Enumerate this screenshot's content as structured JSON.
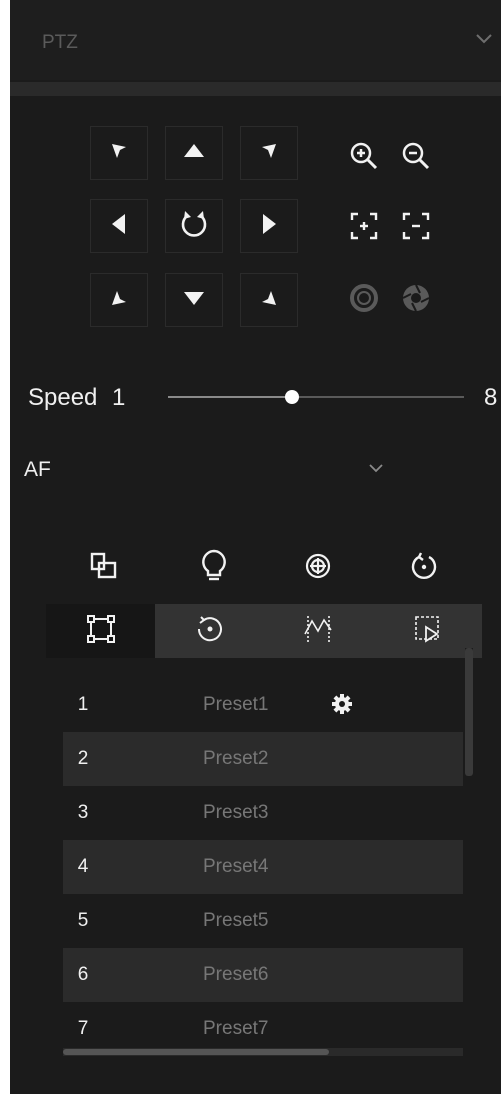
{
  "header": {
    "title": "PTZ",
    "collapse_icon": "chevron-down-icon"
  },
  "directions": [
    {
      "name": "up-left",
      "icon": "arrow-up-left-icon"
    },
    {
      "name": "up",
      "icon": "arrow-up-icon"
    },
    {
      "name": "up-right",
      "icon": "arrow-up-right-icon"
    },
    {
      "name": "left",
      "icon": "arrow-left-icon"
    },
    {
      "name": "auto-pan",
      "icon": "rotate-icon"
    },
    {
      "name": "right",
      "icon": "arrow-right-icon"
    },
    {
      "name": "down-left",
      "icon": "arrow-down-left-icon"
    },
    {
      "name": "down",
      "icon": "arrow-down-icon"
    },
    {
      "name": "down-right",
      "icon": "arrow-down-right-icon"
    }
  ],
  "lens_controls": [
    "zoom-in-icon",
    "zoom-out-icon",
    "focus-near-icon",
    "focus-far-icon",
    "iris-close-icon",
    "iris-open-icon"
  ],
  "speed": {
    "label": "Speed",
    "value": "1",
    "max_label": "8",
    "level_fraction": 0.42
  },
  "focus_mode": {
    "value": "AF"
  },
  "function_icons": [
    "window-icon",
    "light-bulb-icon",
    "target-icon",
    "reset-icon"
  ],
  "tabs": [
    {
      "name": "preset",
      "icon": "preset-frame-icon",
      "active": true
    },
    {
      "name": "cruise",
      "icon": "cruise-circle-icon",
      "active": false
    },
    {
      "name": "pattern",
      "icon": "pattern-icon",
      "active": false
    },
    {
      "name": "track",
      "icon": "track-play-icon",
      "active": false
    }
  ],
  "presets": [
    {
      "num": "1",
      "name": "Preset1",
      "has_settings": true
    },
    {
      "num": "2",
      "name": "Preset2"
    },
    {
      "num": "3",
      "name": "Preset3"
    },
    {
      "num": "4",
      "name": "Preset4"
    },
    {
      "num": "5",
      "name": "Preset5"
    },
    {
      "num": "6",
      "name": "Preset6"
    },
    {
      "num": "7",
      "name": "Preset7"
    }
  ],
  "colors": {
    "background": "#1b1b1b",
    "text": "#f0f0f0",
    "muted_text": "#777777",
    "row_alt": "#2b2b2b",
    "tabbar": "#333333"
  }
}
